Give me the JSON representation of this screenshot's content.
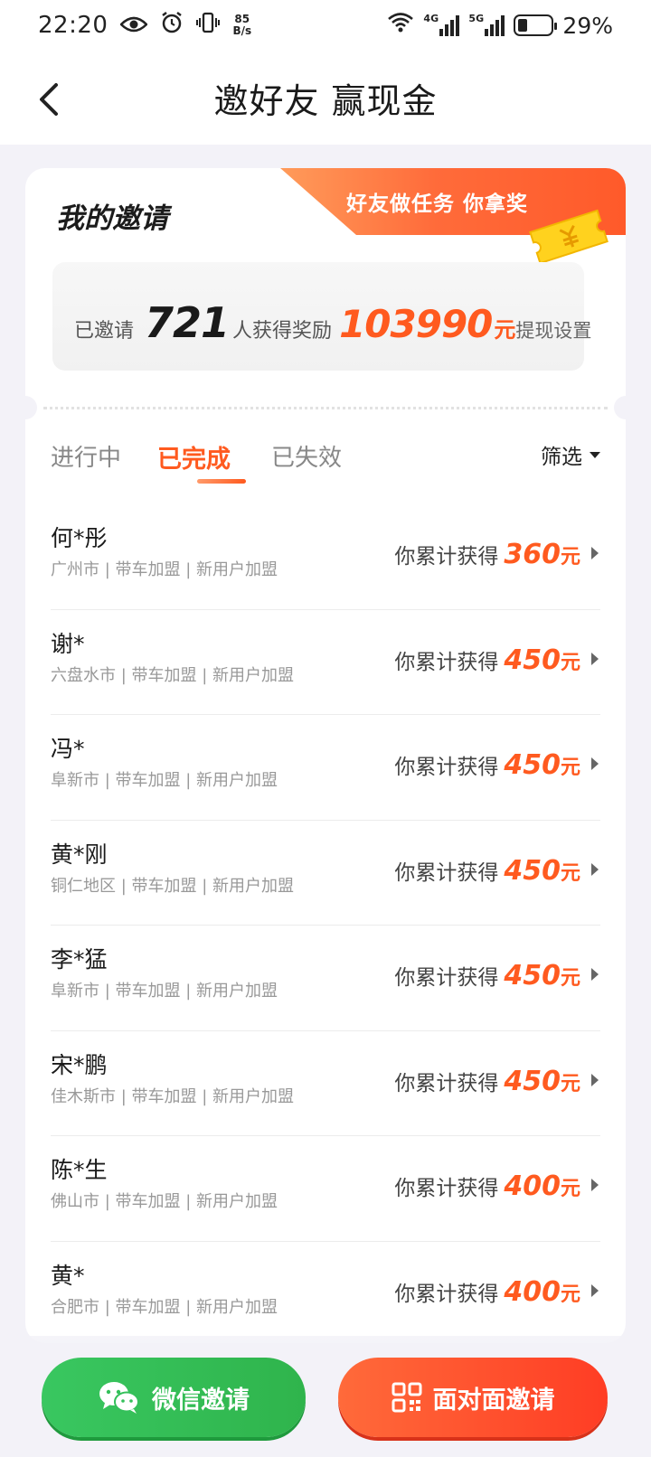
{
  "status_bar": {
    "time": "22:20",
    "net_speed_value": "85",
    "net_speed_unit": "B/s",
    "signal1_label": "4G",
    "signal2_label": "5G",
    "battery_percent": "29%",
    "battery_level": 0.29
  },
  "header": {
    "title": "邀好友 赢现金"
  },
  "invite_card": {
    "title": "我的邀请",
    "ribbon_text": "好友做任务 你拿奖",
    "invited_label": "已邀请",
    "invited_count": "721",
    "rewarded_label": "人获得奖励",
    "reward_amount": "103990",
    "reward_unit": "元",
    "withdraw_settings": "提现设置"
  },
  "tabs": [
    {
      "label": "进行中",
      "active": false
    },
    {
      "label": "已完成",
      "active": true
    },
    {
      "label": "已失效",
      "active": false
    }
  ],
  "filter_label": "筛选",
  "earn_label": "你累计获得",
  "currency_unit": "元",
  "invitees": [
    {
      "name": "何*彤",
      "info": "广州市 | 带车加盟 | 新用户加盟",
      "amount": "360"
    },
    {
      "name": "谢*",
      "info": "六盘水市 | 带车加盟 | 新用户加盟",
      "amount": "450"
    },
    {
      "name": "冯*",
      "info": "阜新市 | 带车加盟 | 新用户加盟",
      "amount": "450"
    },
    {
      "name": "黄*刚",
      "info": "铜仁地区 | 带车加盟 | 新用户加盟",
      "amount": "450"
    },
    {
      "name": "李*猛",
      "info": "阜新市 | 带车加盟 | 新用户加盟",
      "amount": "450"
    },
    {
      "name": "宋*鹏",
      "info": "佳木斯市 | 带车加盟 | 新用户加盟",
      "amount": "450"
    },
    {
      "name": "陈*生",
      "info": "佛山市 | 带车加盟 | 新用户加盟",
      "amount": "400"
    },
    {
      "name": "黄*",
      "info": "合肥市 | 带车加盟 | 新用户加盟",
      "amount": "400"
    }
  ],
  "bottom": {
    "wechat_label": "微信邀请",
    "f2f_label": "面对面邀请"
  },
  "colors": {
    "accent": "#ff5a1f",
    "wechat_green": "#34c05a",
    "page_bg": "#f3f2f8"
  }
}
